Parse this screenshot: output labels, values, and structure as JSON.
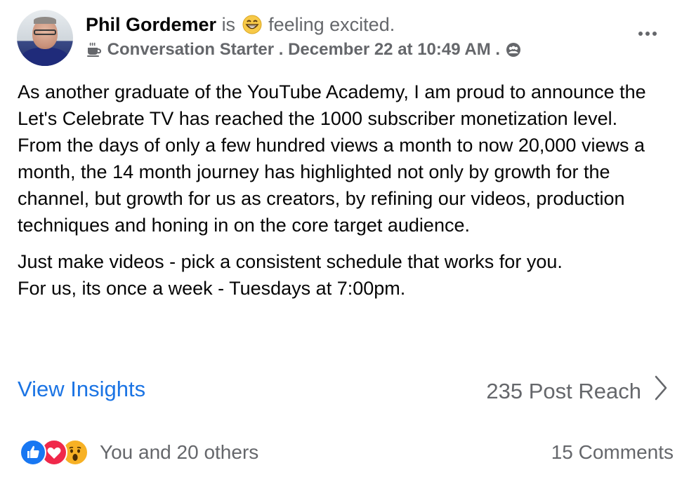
{
  "post": {
    "author": "Phil Gordemer",
    "is_text": "is",
    "feeling_icon": "grinning-face-emoji",
    "feeling_text": "feeling excited.",
    "badge_icon": "coffee-cup-icon",
    "badge": "Conversation Starter",
    "separator": ".",
    "timestamp": "December 22 at 10:49 AM",
    "audience_icon": "group-audience-icon",
    "paragraphs": [
      "As another graduate of the YouTube Academy, I am proud to announce the Let's Celebrate TV has reached the 1000 subscriber monetization level.",
      "From the days of only a few hundred views a month to now 20,000 views a month, the 14 month journey has highlighted not only by growth for the channel, but growth for us as creators, by refining our videos, production techniques and honing in on the core target audience.",
      "Just make videos - pick a consistent schedule that works for you.",
      "For us, its once a week - Tuesdays at 7:00pm."
    ]
  },
  "insights": {
    "link_label": "View Insights",
    "reach_label": "235 Post Reach",
    "reach_icon": "chevron-right-icon"
  },
  "footer": {
    "reaction_icons": [
      "like-reaction-icon",
      "love-reaction-icon",
      "wow-reaction-icon"
    ],
    "reactions_text": "You and 20 others",
    "comments_text": "15 Comments"
  },
  "colors": {
    "link_blue": "#1b74e4",
    "muted_gray": "#65676b",
    "like_blue": "#1877f2",
    "love_red": "#f0284a",
    "wow_yellow": "#f7b125"
  }
}
